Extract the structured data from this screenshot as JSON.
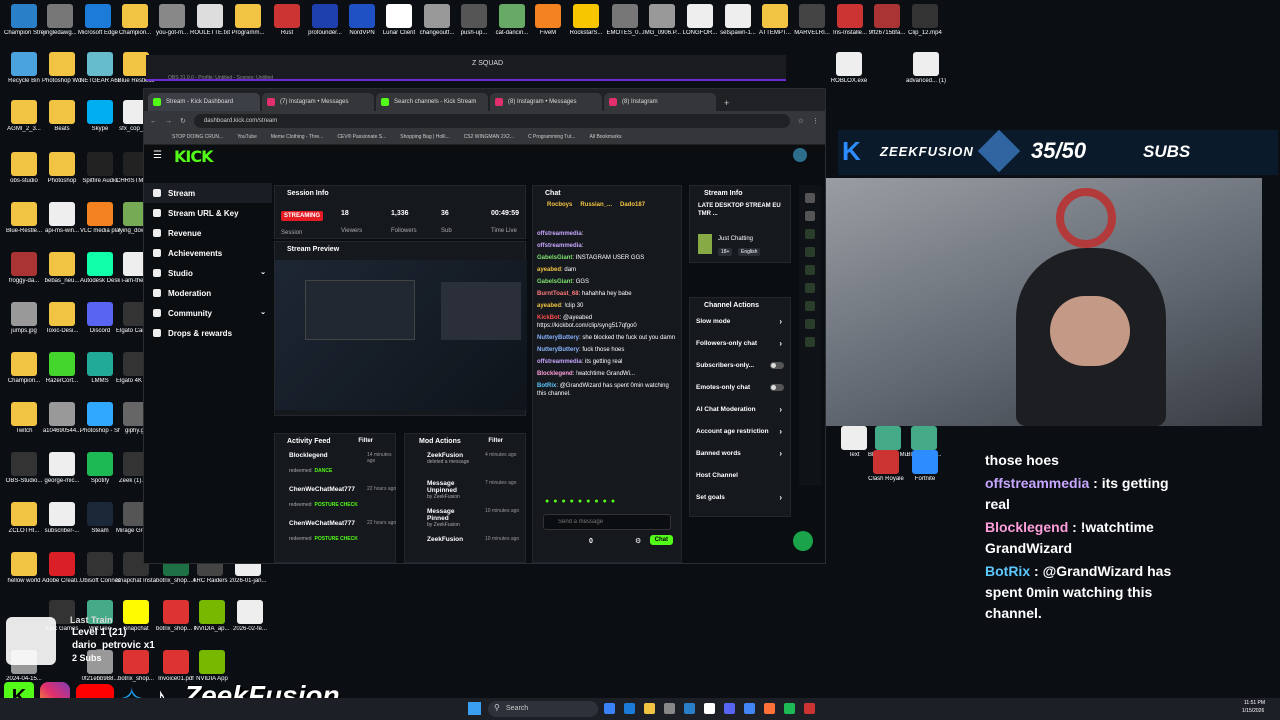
{
  "colors": {
    "kick_green": "#53fc18",
    "streaming_red": "#e51c23",
    "accent_blue": "#2d8cff"
  },
  "desktop_icons": [
    {
      "label": "Champion Stream Ov...",
      "color": "#2a7fc9"
    },
    {
      "label": "jingledawg...",
      "color": "#777"
    },
    {
      "label": "Microsoft Edge",
      "color": "#1c7ad8"
    },
    {
      "label": "Champion...",
      "color": "#f2c443"
    },
    {
      "label": "you-got-m...",
      "color": "#888"
    },
    {
      "label": "ROULETTE.txt",
      "color": "#ddd"
    },
    {
      "label": "Programm...",
      "color": "#f2c443"
    },
    {
      "label": "Rust",
      "color": "#c33"
    },
    {
      "label": "profounder...",
      "color": "#1e40af"
    },
    {
      "label": "NordVPN",
      "color": "#2051c4"
    },
    {
      "label": "Lunar Client",
      "color": "#fff"
    },
    {
      "label": "changeoutf...",
      "color": "#999"
    },
    {
      "label": "push-up...",
      "color": "#555"
    },
    {
      "label": "cat-dancin...",
      "color": "#6a6"
    },
    {
      "label": "FiveM",
      "color": "#f58220"
    },
    {
      "label": "RockstarS...",
      "color": "#f7c600"
    },
    {
      "label": "EMOTES_0...",
      "color": "#777"
    },
    {
      "label": "IMG_0906.P...",
      "color": "#999"
    },
    {
      "label": "LONGFOR...",
      "color": "#eee"
    },
    {
      "label": "setspawn-1...",
      "color": "#eee"
    },
    {
      "label": "ATTEMPT...",
      "color": "#f2c443"
    },
    {
      "label": "MARVELRI...",
      "color": "#444"
    },
    {
      "label": "Iris-Installe...",
      "color": "#c33"
    },
    {
      "label": "9ff26715bfa...",
      "color": "#a33"
    },
    {
      "label": "Clip_12.mp4",
      "color": "#333"
    },
    {
      "label": "Recycle Bin",
      "color": "#4aa3df"
    },
    {
      "label": "Photoshop Work",
      "color": "#f2c443"
    },
    {
      "label": "NETGEAR A6210 Genie",
      "color": "#6bc"
    },
    {
      "label": "Blue Restless",
      "color": "#f2c443"
    },
    {
      "label": "AGMI_2_3...",
      "color": "#f2c443"
    },
    {
      "label": "Beats",
      "color": "#f2c443"
    },
    {
      "label": "Skype",
      "color": "#00aff0"
    },
    {
      "label": "sfx_cop_fx...",
      "color": "#eee"
    },
    {
      "label": "obs-studio",
      "color": "#f2c443"
    },
    {
      "label": "Photoshop",
      "color": "#f2c443"
    },
    {
      "label": "Spitfire Audio",
      "color": "#222"
    },
    {
      "label": "CHRISTMAS...",
      "color": "#222"
    },
    {
      "label": "Blue-Restle...",
      "color": "#f2c443"
    },
    {
      "label": "api-ms-win...",
      "color": "#eee"
    },
    {
      "label": "VLC media player",
      "color": "#f58220"
    },
    {
      "label": "lying_down...",
      "color": "#7a5"
    },
    {
      "label": "froggy-da...",
      "color": "#a33"
    },
    {
      "label": "bebas_neu...",
      "color": "#f2c443"
    },
    {
      "label": "Autodesk Desktop App",
      "color": "#1fa"
    },
    {
      "label": "i-am-the-...",
      "color": "#eee"
    },
    {
      "label": "jumps.jpg",
      "color": "#999"
    },
    {
      "label": "Toxic-Desi...",
      "color": "#f2c443"
    },
    {
      "label": "Discord",
      "color": "#5865f2"
    },
    {
      "label": "Elgato Camera Hub",
      "color": "#333"
    },
    {
      "label": "Champion...",
      "color": "#f2c443"
    },
    {
      "label": "RazerCort...",
      "color": "#44d62c"
    },
    {
      "label": "LMMS",
      "color": "#2a9"
    },
    {
      "label": "Elgato 4K Captur...",
      "color": "#333"
    },
    {
      "label": "Twitch",
      "color": "#f2c443"
    },
    {
      "label": "a104690544...",
      "color": "#999"
    },
    {
      "label": "Photoshop - Shortcut",
      "color": "#31a8ff"
    },
    {
      "label": "giphy.gif",
      "color": "#666"
    },
    {
      "label": "OBS-Studio...",
      "color": "#333"
    },
    {
      "label": "george-mic...",
      "color": "#eee"
    },
    {
      "label": "Spotify",
      "color": "#1db954"
    },
    {
      "label": "Zeek (1).m...",
      "color": "#333"
    },
    {
      "label": "ZCLOTHI...",
      "color": "#f2c443"
    },
    {
      "label": "subscriber-...",
      "color": "#eee"
    },
    {
      "label": "Steam",
      "color": "#1b2838"
    },
    {
      "label": "Mirage Gre Gaming St...",
      "color": "#555"
    },
    {
      "label": "hellow world",
      "color": "#f2c443"
    },
    {
      "label": "Adobe Creati...",
      "color": "#da1f26"
    },
    {
      "label": "Ubisoft Connect",
      "color": "#333"
    },
    {
      "label": "Snapchat Installer.exe",
      "color": "#333"
    },
    {
      "label": "botrix_shop... PM.xlsx",
      "color": "#1e7145"
    },
    {
      "label": "ARC Raiders",
      "color": "#444"
    },
    {
      "label": "2026-01-jan...",
      "color": "#eee"
    },
    {
      "label": "Epic Games",
      "color": "#333"
    },
    {
      "label": "WizTree",
      "color": "#4a8"
    },
    {
      "label": "Snapchat",
      "color": "#fffc00"
    },
    {
      "label": "botrix_shop... PM.pdf",
      "color": "#d33"
    },
    {
      "label": "NVIDIA_ap...",
      "color": "#76b900"
    },
    {
      "label": "2026-02-fe...",
      "color": "#eee"
    },
    {
      "label": "2024-04-15...",
      "color": "#999"
    },
    {
      "label": "Invoice01.pdf",
      "color": "#d33"
    },
    {
      "label": "0f21ebb988...",
      "color": "#999"
    },
    {
      "label": "botrix_shop...",
      "color": "#d33"
    },
    {
      "label": "NVIDIA App",
      "color": "#76b900"
    },
    {
      "label": "ROBLOX.exe",
      "color": "#eee"
    },
    {
      "label": "advanced... (1).lua",
      "color": "#eee"
    },
    {
      "label": "Text",
      "color": "#eee"
    },
    {
      "label": "BlueStacks Multi-Insta...",
      "color": "#4a8"
    },
    {
      "label": "BlueStacks...",
      "color": "#4a8"
    },
    {
      "label": "Clash Royale",
      "color": "#c33"
    },
    {
      "label": "Fortnite",
      "color": "#2d8cff"
    }
  ],
  "obs": {
    "title": "OBS 31.0.0 - Profile: Untitled - Scenes: Untitled",
    "scene_title": "Z SQUAD"
  },
  "browser": {
    "tabs": [
      "Stream - Kick Dashboard",
      "(7) Instagram • Messages",
      "Search channels - Kick Stream",
      "(8) Instagram • Messages",
      "(8) Instagram"
    ],
    "url": "dashboard.kick.com/stream",
    "bookmarks": [
      "STOP DOING CRUN...",
      "YouTube",
      "Meme Clothing - Thre...",
      "CEV® Passionate S...",
      "Shopping Bag | Holli...",
      "CS2 WINGMAN 2X2...",
      "C Programming Tut...",
      "All Bookmarks"
    ]
  },
  "kick": {
    "logo": "KICK",
    "nav": [
      "Stream",
      "Stream URL & Key",
      "Revenue",
      "Achievements",
      "Studio",
      "Moderation",
      "Community",
      "Drops & rewards"
    ],
    "session": {
      "title": "Session Info",
      "status": "STREAMING",
      "status_label": "Session",
      "viewers": "18",
      "viewers_label": "Viewers",
      "followers": "1,336",
      "followers_label": "Followers",
      "subs": "36",
      "subs_label": "Sub",
      "time": "00:49:59",
      "time_label": "Time Live"
    },
    "preview_title": "Stream Preview",
    "activity": {
      "title": "Activity Feed",
      "filter": "Filter",
      "items": [
        {
          "user": "Blocklegend",
          "time": "14 minutes ago",
          "action": "redeemed",
          "reward": "DANCE"
        },
        {
          "user": "ChenWeChatMeat777",
          "time": "22 hours ago",
          "action": "redeemed",
          "reward": "POSTURE CHECK"
        },
        {
          "user": "ChenWeChatMeat777",
          "time": "22 hours ago",
          "action": "redeemed",
          "reward": "POSTURE CHECK"
        }
      ]
    },
    "mod": {
      "title": "Mod Actions",
      "filter": "Filter",
      "items": [
        {
          "user": "ZeekFusion",
          "sub": "deleted a message",
          "time": "4 minutes ago"
        },
        {
          "user": "Message Unpinned",
          "sub": "by ZeekFusion",
          "time": "7 minutes ago"
        },
        {
          "user": "Message Pinned",
          "sub": "by ZeekFusion",
          "time": "10 minutes ago"
        },
        {
          "user": "ZeekFusion",
          "sub": "",
          "time": "10 minutes ago"
        }
      ]
    },
    "chat": {
      "title": "Chat",
      "top": [
        {
          "name": "Rocboys",
          "n": "1"
        },
        {
          "name": "Russian_...",
          "n": "5"
        },
        {
          "name": "Dado187",
          "n": ""
        }
      ],
      "messages": [
        {
          "user": "offstreammedia",
          "text": ""
        },
        {
          "user": "offstreammedia",
          "text": ""
        },
        {
          "user": "GabelsGiant",
          "text": "INSTAGRAM USER GGS"
        },
        {
          "user": "ayeabed",
          "text": "dam"
        },
        {
          "user": "GabelsGiant",
          "text": "GGS"
        },
        {
          "user": "BurntToast_68",
          "text": "hahahha hey babe"
        },
        {
          "user": "ayeabed",
          "text": "!clip 30"
        },
        {
          "user": "KickBot",
          "text": "@ayeabed https://kickbot.com/clip/syng517qfgo0"
        },
        {
          "user": "NutteryButtery",
          "text": "she blocked the fuck out you damn"
        },
        {
          "user": "NutteryButtery",
          "text": "fuck those hoes"
        },
        {
          "user": "offstreammedia",
          "text": "its getting real"
        },
        {
          "user": "Blocklegend",
          "text": "!watchtime GrandWi..."
        },
        {
          "user": "BotRix",
          "text": "@GrandWizard has spent 0min watching this channel."
        }
      ],
      "placeholder": "Send a message",
      "count": "0",
      "send": "Chat"
    },
    "info": {
      "title": "Stream Info",
      "stream_title": "LATE DESKTOP STREAM EU TMR ...",
      "category": "Just Chatting",
      "tag1": "18+",
      "tag2": "English"
    },
    "actions": {
      "title": "Channel Actions",
      "items": [
        "Slow mode",
        "Followers-only chat",
        "Subscribers-only...",
        "Emotes-only chat",
        "AI Chat Moderation",
        "Account age restriction",
        "Banned words",
        "Host Channel",
        "Set goals"
      ]
    }
  },
  "overlay": {
    "brand": "ZEEKFUSION",
    "sub_count": "35/50",
    "subs_label": "SUBS",
    "chat": [
      {
        "user": "",
        "text": "those hoes"
      },
      {
        "user": "offstreammedia",
        "text": " : its getting real"
      },
      {
        "user": "Blocklegend",
        "text": " : !watchtime GrandWizard"
      },
      {
        "user": "BotRix",
        "text": " : @GrandWizard has spent 0min watching this channel."
      }
    ],
    "last_train": "Last Train",
    "level": "Level 1 (21)",
    "name": "dario_petrovic x1",
    "subs": "2 Subs",
    "brand_bottom": "ZeekFusion"
  },
  "taskbar": {
    "search": "Search",
    "time": "11:51 PM",
    "date": "1/15/2026"
  }
}
